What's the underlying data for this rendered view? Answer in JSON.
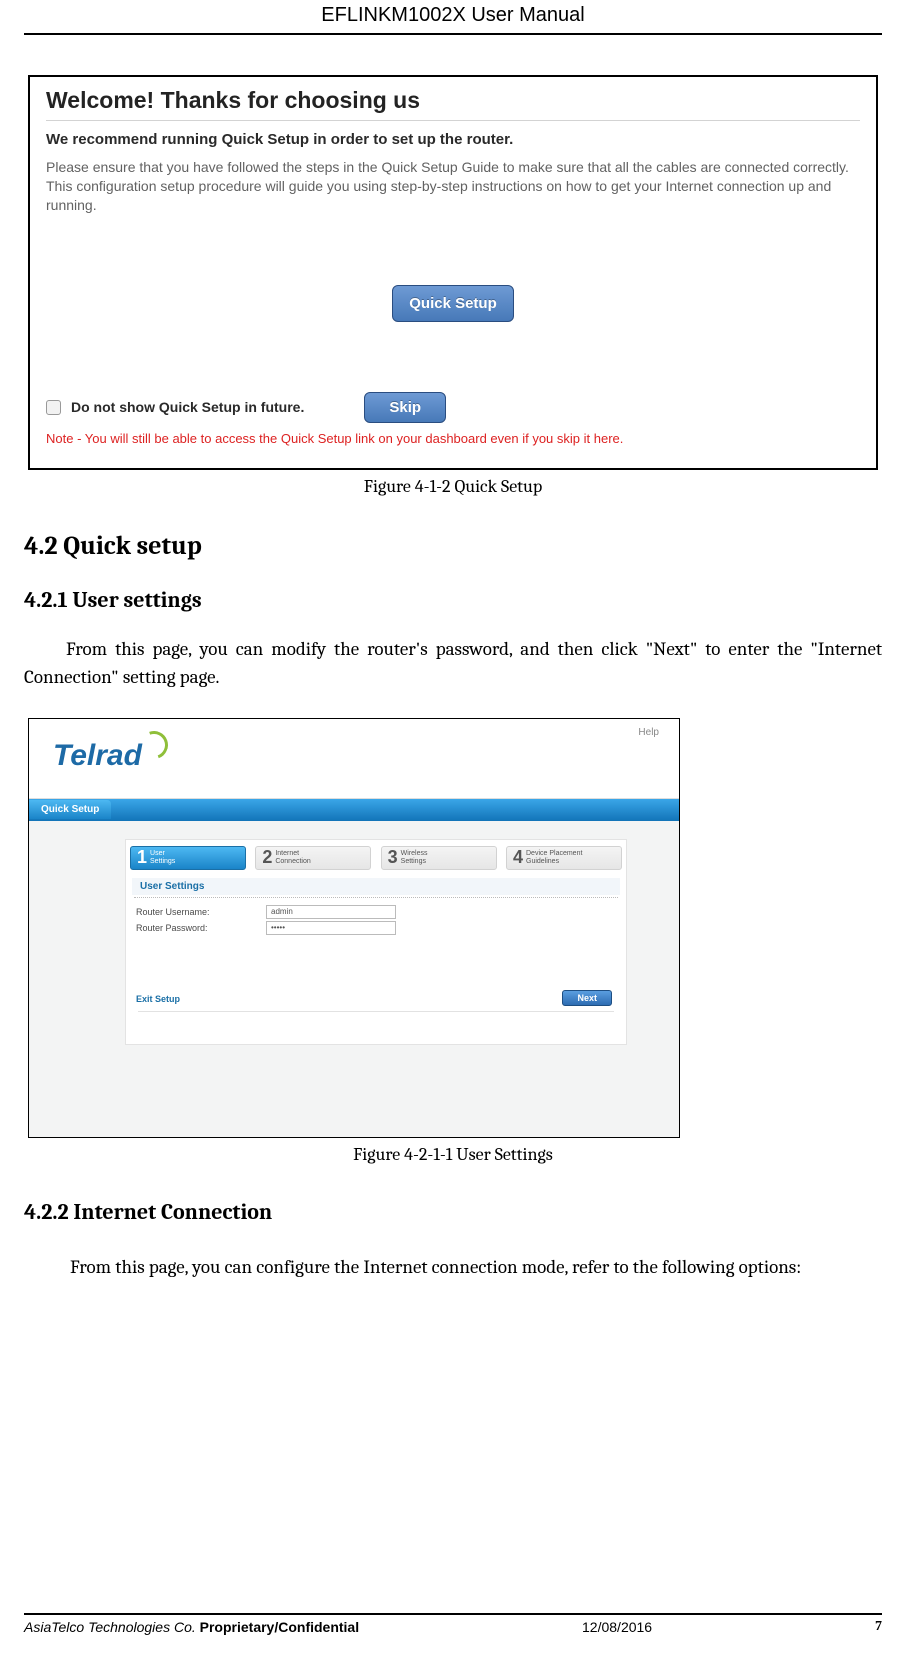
{
  "header": {
    "title": "EFLINKM1002X User Manual"
  },
  "fig1": {
    "welcome": "Welcome!  Thanks for choosing us",
    "recommend": "We recommend running Quick Setup in order to set up the router.",
    "instr": "Please ensure that you have followed the steps in the Quick Setup Guide to make sure that all the cables are connected correctly. This configuration setup procedure will guide you using step-by-step instructions on how to get your Internet connection up and running.",
    "qs_btn": "Quick Setup",
    "cb_label": "Do not show Quick Setup in future.",
    "skip_btn": "Skip",
    "note": "Note - You will still be able to access the Quick Setup link on your dashboard even if you skip it here."
  },
  "caption1": "Figure 4-1-2 Quick Setup",
  "sec_42": "4.2 Quick setup",
  "sub_421": "4.2.1 User settings",
  "para_421": "From this page, you can modify the router's password, and then click \"Next\" to enter the \"Internet Connection\" setting page.",
  "fig2": {
    "help": "Help",
    "logo": "Telrad",
    "tab": "Quick Setup",
    "steps": [
      {
        "num": "1",
        "line1": "User",
        "line2": "Settings",
        "active": true
      },
      {
        "num": "2",
        "line1": "Internet",
        "line2": "Connection",
        "active": false
      },
      {
        "num": "3",
        "line1": "Wireless",
        "line2": "Settings",
        "active": false
      },
      {
        "num": "4",
        "line1": "Device Placement",
        "line2": "Guidelines",
        "active": false
      }
    ],
    "section_title": "User Settings",
    "rows": [
      {
        "label": "Router Username:",
        "value": "admin"
      },
      {
        "label": "Router Password:",
        "value": "•••••"
      }
    ],
    "exit": "Exit Setup",
    "next": "Next"
  },
  "caption2": "Figure 4-2-1-1 User Settings",
  "sub_422": "4.2.2 Internet Connection",
  "para_422": "From this page, you can configure the Internet connection mode, refer to the following options:",
  "footer": {
    "company": "AsiaTelco Technologies Co.",
    "pc": " Proprietary/Confidential",
    "date": "12/08/2016",
    "page": "7"
  },
  "chart_data": {
    "type": "table",
    "title": "User Settings",
    "rows": [
      {
        "field": "Router Username",
        "value": "admin"
      },
      {
        "field": "Router Password",
        "value": "•••••"
      }
    ]
  }
}
